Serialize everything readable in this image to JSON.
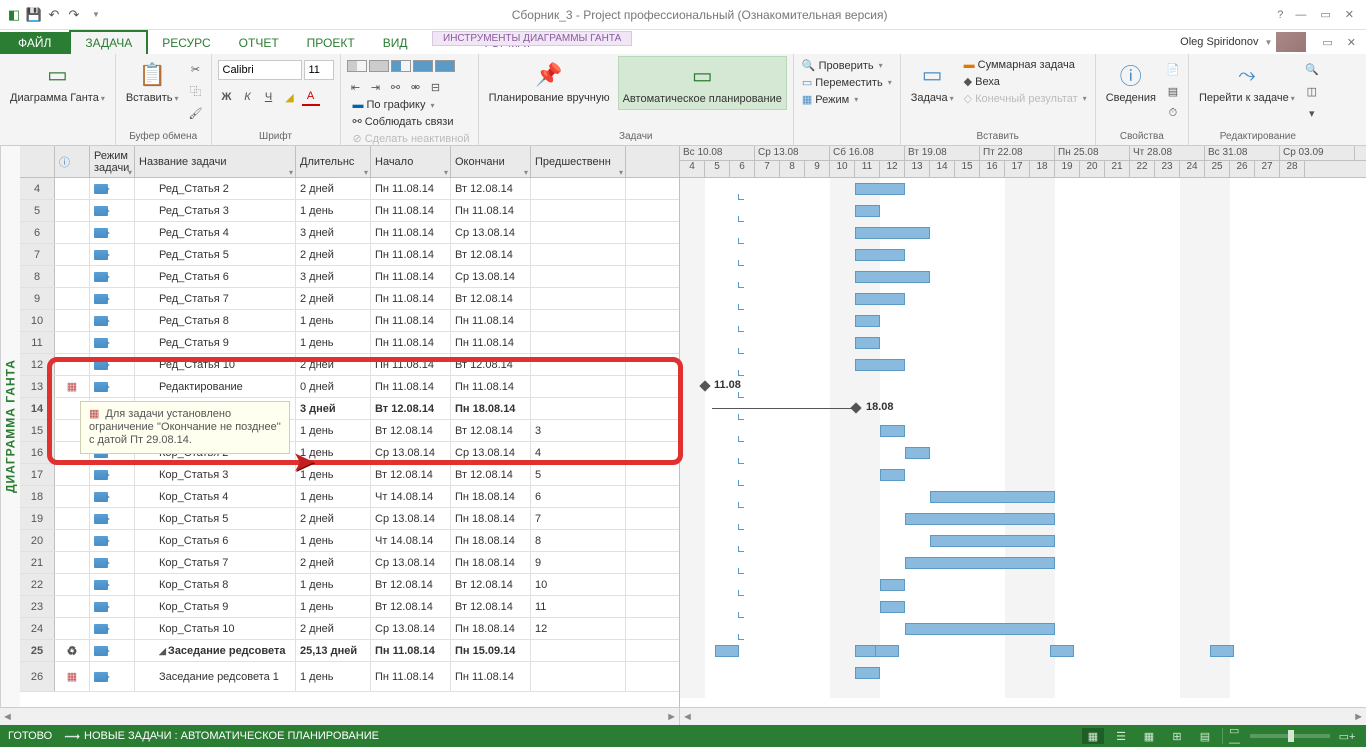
{
  "title_bar": {
    "context_tab": "ИНСТРУМЕНТЫ ДИАГРАММЫ ГАНТА",
    "document": "Сборник_3 - Project профессиональный (Ознакомительная версия)",
    "user": "Oleg Spiridonov"
  },
  "tabs": {
    "file": "ФАЙЛ",
    "task": "ЗАДАЧА",
    "resource": "РЕСУРС",
    "report": "ОТЧЕТ",
    "project": "ПРОЕКТ",
    "view": "ВИД",
    "format": "ФОРМАТ"
  },
  "ribbon": {
    "gantt": "Диаграмма Ганта",
    "paste": "Вставить",
    "clipboard": "Буфер обмена",
    "font_name": "Calibri",
    "font_size": "11",
    "font": "Шрифт",
    "on_schedule": "По графику",
    "respect_links": "Соблюдать связи",
    "inactivate": "Сделать неактивной",
    "planning": "Планирование",
    "manual": "Планирование вручную",
    "auto": "Автоматическое планирование",
    "tasks": "Задачи",
    "inspect": "Проверить",
    "move": "Переместить",
    "mode": "Режим",
    "task_g": "Задача",
    "summary": "Суммарная задача",
    "milestone": "Веха",
    "deliverable": "Конечный результат",
    "insert": "Вставить",
    "info": "Сведения",
    "props": "Свойства",
    "scroll_to": "Перейти к задаче",
    "editing": "Редактирование"
  },
  "columns": {
    "mode": "Режим задачи",
    "name": "Название задачи",
    "dur": "Длительнс",
    "start": "Начало",
    "end": "Окончани",
    "pred": "Предшественн"
  },
  "side_label": "ДИАГРАММА ГАНТА",
  "rows": [
    {
      "n": "4",
      "name": "Ред_Статья 2",
      "dur": "2 дней",
      "s": "Пн 11.08.14",
      "e": "Вт 12.08.14",
      "p": ""
    },
    {
      "n": "5",
      "name": "Ред_Статья 3",
      "dur": "1 день",
      "s": "Пн 11.08.14",
      "e": "Пн 11.08.14",
      "p": ""
    },
    {
      "n": "6",
      "name": "Ред_Статья 4",
      "dur": "3 дней",
      "s": "Пн 11.08.14",
      "e": "Ср 13.08.14",
      "p": ""
    },
    {
      "n": "7",
      "name": "Ред_Статья 5",
      "dur": "2 дней",
      "s": "Пн 11.08.14",
      "e": "Вт 12.08.14",
      "p": ""
    },
    {
      "n": "8",
      "name": "Ред_Статья 6",
      "dur": "3 дней",
      "s": "Пн 11.08.14",
      "e": "Ср 13.08.14",
      "p": ""
    },
    {
      "n": "9",
      "name": "Ред_Статья 7",
      "dur": "2 дней",
      "s": "Пн 11.08.14",
      "e": "Вт 12.08.14",
      "p": ""
    },
    {
      "n": "10",
      "name": "Ред_Статья 8",
      "dur": "1 день",
      "s": "Пн 11.08.14",
      "e": "Пн 11.08.14",
      "p": ""
    },
    {
      "n": "11",
      "name": "Ред_Статья 9",
      "dur": "1 день",
      "s": "Пн 11.08.14",
      "e": "Пн 11.08.14",
      "p": ""
    },
    {
      "n": "12",
      "name": "Ред_Статья 10",
      "dur": "2 дней",
      "s": "Пн 11.08.14",
      "e": "Вт 12.08.14",
      "p": ""
    },
    {
      "n": "13",
      "name": "Редактирование",
      "dur": "0 дней",
      "s": "Пн 11.08.14",
      "e": "Пн 11.08.14",
      "p": "",
      "icon": "cal"
    },
    {
      "n": "14",
      "name": "",
      "dur": "3 дней",
      "s": "Вт 12.08.14",
      "e": "Пн 18.08.14",
      "p": "",
      "bold": true
    },
    {
      "n": "15",
      "name": "",
      "dur": "1 день",
      "s": "Вт 12.08.14",
      "e": "Вт 12.08.14",
      "p": "3"
    },
    {
      "n": "16",
      "name": "Кор_Статья 2",
      "dur": "1 день",
      "s": "Ср 13.08.14",
      "e": "Ср 13.08.14",
      "p": "4"
    },
    {
      "n": "17",
      "name": "Кор_Статья 3",
      "dur": "1 день",
      "s": "Вт 12.08.14",
      "e": "Вт 12.08.14",
      "p": "5"
    },
    {
      "n": "18",
      "name": "Кор_Статья 4",
      "dur": "1 день",
      "s": "Чт 14.08.14",
      "e": "Пн 18.08.14",
      "p": "6"
    },
    {
      "n": "19",
      "name": "Кор_Статья 5",
      "dur": "2 дней",
      "s": "Ср 13.08.14",
      "e": "Пн 18.08.14",
      "p": "7"
    },
    {
      "n": "20",
      "name": "Кор_Статья 6",
      "dur": "1 день",
      "s": "Чт 14.08.14",
      "e": "Пн 18.08.14",
      "p": "8"
    },
    {
      "n": "21",
      "name": "Кор_Статья 7",
      "dur": "2 дней",
      "s": "Ср 13.08.14",
      "e": "Пн 18.08.14",
      "p": "9"
    },
    {
      "n": "22",
      "name": "Кор_Статья 8",
      "dur": "1 день",
      "s": "Вт 12.08.14",
      "e": "Вт 12.08.14",
      "p": "10"
    },
    {
      "n": "23",
      "name": "Кор_Статья 9",
      "dur": "1 день",
      "s": "Вт 12.08.14",
      "e": "Вт 12.08.14",
      "p": "11"
    },
    {
      "n": "24",
      "name": "Кор_Статья 10",
      "dur": "2 дней",
      "s": "Ср 13.08.14",
      "e": "Пн 18.08.14",
      "p": "12"
    },
    {
      "n": "25",
      "name": "Заседание редсовета",
      "dur": "25,13 дней",
      "s": "Пн 11.08.14",
      "e": "Пн 15.09.14",
      "p": "",
      "bold": true,
      "tri": true,
      "iconr": true
    },
    {
      "n": "26",
      "name": "Заседание редсовета 1",
      "dur": "1 день",
      "s": "Пн 11.08.14",
      "e": "Пн 11.08.14",
      "p": "",
      "icon": "cal",
      "tall": true
    }
  ],
  "tooltip": "Для задачи установлено ограничение ''Окончание не позднее'' с датой Пт 29.08.14.",
  "gantt": {
    "weeks": [
      "Вс 10.08",
      "Ср 13.08",
      "Сб 16.08",
      "Вт 19.08",
      "Пт 22.08",
      "Пн 25.08",
      "Чт 28.08",
      "Вс 31.08",
      "Ср 03.09"
    ],
    "days": [
      "4",
      "5",
      "6",
      "7",
      "8",
      "9",
      "10",
      "11",
      "12",
      "13",
      "14",
      "15",
      "16",
      "17",
      "18",
      "19",
      "20",
      "21",
      "22",
      "23",
      "24",
      "25",
      "26",
      "27",
      "28"
    ],
    "milestone1": "11.08",
    "milestone2": "18.08"
  },
  "status": {
    "ready": "ГОТОВО",
    "mode": "НОВЫЕ ЗАДАЧИ : АВТОМАТИЧЕСКОЕ ПЛАНИРОВАНИЕ"
  }
}
